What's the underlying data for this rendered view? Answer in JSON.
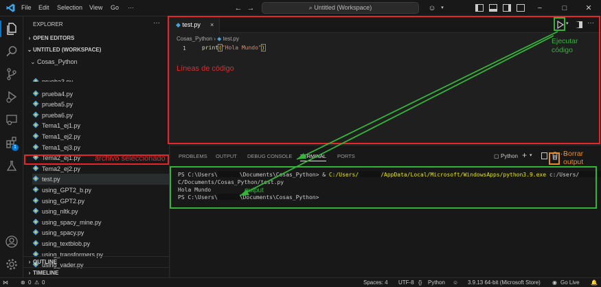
{
  "titlebar": {
    "menus": [
      "File",
      "Edit",
      "Selection",
      "View",
      "Go"
    ],
    "search": "Untitled (Workspace)",
    "dots": "···"
  },
  "sidebar": {
    "title": "EXPLORER",
    "dots": "···",
    "open_editors": "OPEN EDITORS",
    "workspace": "UNTITLED (WORKSPACE)",
    "folder": "Cosas_Python",
    "files": [
      "prueba3.py",
      "prueba4.py",
      "prueba5.py",
      "prueba6.py",
      "Tema1_ej1.py",
      "Tema1_ej2.py",
      "Tema1_ej3.py",
      "Tema2_ej1.py",
      "Tema2_ej2.py",
      "test.py",
      "using_GPT2_b.py",
      "using_GPT2.py",
      "using_nltk.py",
      "using_spacy_mine.py",
      "using_spacy.py",
      "using_textblob.py",
      "using_transformers.py",
      "using_vader.py"
    ],
    "outline": "OUTLINE",
    "timeline": "TIMELINE",
    "badge": "1"
  },
  "editor": {
    "tab_label": "test.py",
    "tab_close": "×",
    "crumb_folder": "Cosas_Python",
    "crumb_sep": "›",
    "crumb_file": "test.py",
    "line_number": "1",
    "code_fn": "print",
    "code_paren_open": "(",
    "code_string": "\"Hola Mundo\"",
    "code_paren_close": ")"
  },
  "panel": {
    "tabs": [
      "PROBLEMS",
      "OUTPUT",
      "DEBUG CONSOLE",
      "TERMINAL",
      "PORTS"
    ],
    "shell": "Python",
    "terminal": {
      "l1_a": "PS C:\\Users\\",
      "l1_b": "\\Documents\\Cosas_Python> & ",
      "l1_c": "C:/Users/",
      "l1_d": "/AppData/Local/Microsoft/WindowsApps/python3.9.exe",
      "l1_e": " c:/Users/",
      "l2": "C/Documents/Cosas_Python/test.py",
      "l3": "Hola Mundo",
      "l4_a": "PS C:\\Users\\",
      "l4_b": "\\Documents\\Cosas_Python>"
    }
  },
  "statusbar": {
    "errors": "0",
    "warnings": "0",
    "spaces": "Spaces: 4",
    "encoding": "UTF-8",
    "eol": "{}",
    "language": "Python",
    "interpreter": "3.9.13 64-bit (Microsoft Store)",
    "golive": "Go Live"
  },
  "annotations": {
    "ejecutar": "Ejecutar\ncódigo",
    "lineas": "Líneas de código",
    "archivo": "archivo seleccionado",
    "borrar": "Borrar\noutput",
    "output": "output"
  },
  "colors": {
    "red": "#e8262a",
    "green": "#34b53a",
    "orange": "#e88b2a"
  }
}
